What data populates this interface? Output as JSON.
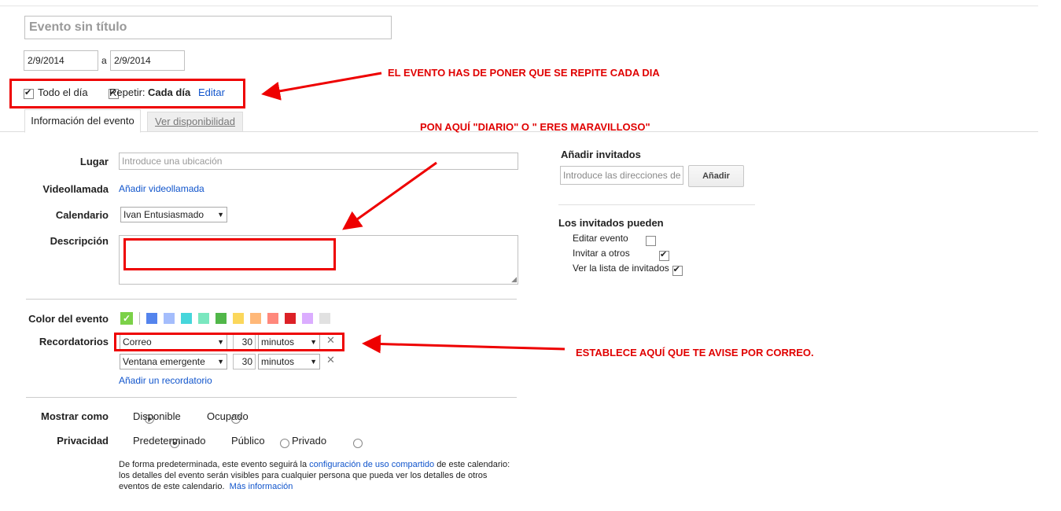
{
  "title": {
    "placeholder": "Evento sin título"
  },
  "dates": {
    "start": "2/9/2014",
    "separator": "a",
    "end": "2/9/2014"
  },
  "options": {
    "all_day": "Todo el día",
    "repeat_label": "Repetir:",
    "repeat_value": "Cada día",
    "edit_link": "Editar"
  },
  "tabs": [
    {
      "label": "Información del evento"
    },
    {
      "label": "Ver disponibilidad"
    }
  ],
  "form": {
    "location_label": "Lugar",
    "location_placeholder": "Introduce una ubicación",
    "video_label": "Videollamada",
    "video_link": "Añadir videollamada",
    "calendar_label": "Calendario",
    "calendar_value": "Ivan Entusiasmado",
    "description_label": "Descripción",
    "color_label": "Color del evento",
    "reminders_label": "Recordatorios",
    "reminders": [
      {
        "method": "Correo",
        "amount": "30",
        "unit": "minutos"
      },
      {
        "method": "Ventana emergente",
        "amount": "30",
        "unit": "minutos"
      }
    ],
    "add_reminder": "Añadir un recordatorio",
    "show_as_label": "Mostrar como",
    "show_as_options": [
      "Disponible",
      "Ocupado"
    ],
    "privacy_label": "Privacidad",
    "privacy_options": [
      "Predeterminado",
      "Público",
      "Privado"
    ],
    "privacy_note_1": "De forma predeterminada, este evento seguirá la",
    "privacy_note_link": "configuración de uso compartido",
    "privacy_note_2": "de este calendario:",
    "privacy_note_3": "los detalles del evento serán visibles para cualquier persona que pueda ver los detalles de otros",
    "privacy_note_4": "eventos de este calendario.",
    "privacy_more_link": "Más información"
  },
  "event_colors": [
    "#7bd148",
    "#5484ed",
    "#a4bdfc",
    "#46d6db",
    "#7ae7bf",
    "#51b749",
    "#fbd75b",
    "#ffb878",
    "#ff887c",
    "#dc2127",
    "#dbadff",
    "#e1e1e1"
  ],
  "guests": {
    "add_title": "Añadir invitados",
    "input_placeholder": "Introduce las direcciones de correo",
    "add_button": "Añadir",
    "can_title": "Los invitados pueden",
    "permissions": [
      {
        "label": "Editar evento",
        "checked": false
      },
      {
        "label": "Invitar a otros",
        "checked": true
      },
      {
        "label": "Ver la lista de invitados",
        "checked": true
      }
    ]
  },
  "annotations": {
    "repeat_note": "EL EVENTO HAS DE PONER QUE SE REPITE CADA DIA",
    "description_note": "PON AQUÍ \"DIARIO\" O \" ERES MARAVILLOSO\"",
    "reminder_note": "ESTABLECE AQUÍ QUE TE AVISE POR CORREO."
  }
}
